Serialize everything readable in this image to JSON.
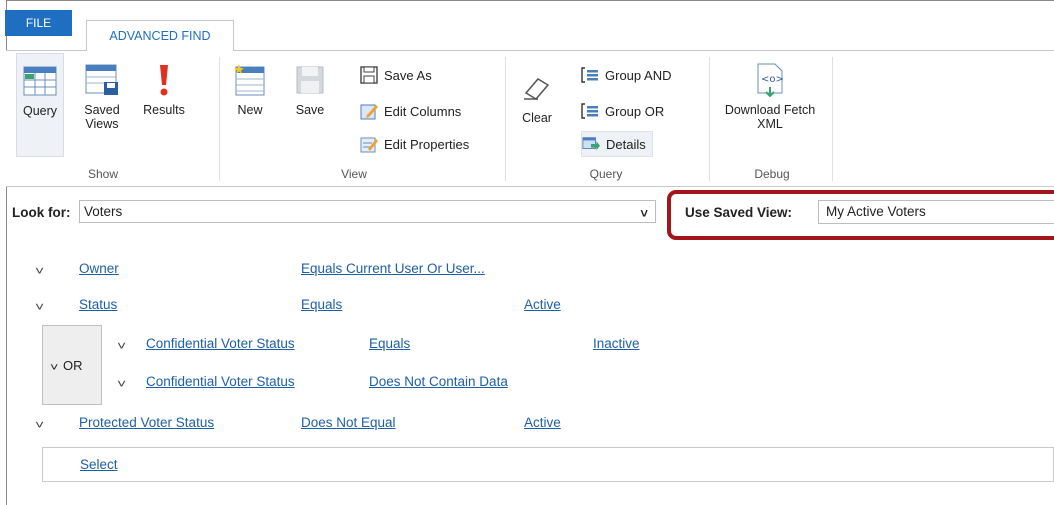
{
  "tabs": {
    "file": "FILE",
    "advanced_find": "ADVANCED FIND"
  },
  "ribbon": {
    "show": {
      "label": "Show",
      "query": "Query",
      "saved_views": "Saved\nViews",
      "results": "Results"
    },
    "view": {
      "label": "View",
      "new": "New",
      "save": "Save",
      "save_as": "Save As",
      "edit_columns": "Edit Columns",
      "edit_properties": "Edit Properties"
    },
    "query": {
      "label": "Query",
      "clear": "Clear",
      "group_and": "Group AND",
      "group_or": "Group OR",
      "details": "Details"
    },
    "debug": {
      "label": "Debug",
      "download_fetch_xml": "Download Fetch\nXML"
    }
  },
  "lookfor": {
    "label": "Look for:",
    "value": "Voters"
  },
  "saved_view": {
    "label": "Use Saved View:",
    "value": "My Active Voters"
  },
  "criteria": [
    {
      "field": "Owner",
      "operator": "Equals Current User Or User...",
      "value": ""
    },
    {
      "field": "Status",
      "operator": "Equals",
      "value": "Active"
    },
    {
      "field": "Protected Voter Status",
      "operator": "Does Not Equal",
      "value": "Active"
    }
  ],
  "or_group": {
    "label": "OR",
    "rows": [
      {
        "field": "Confidential Voter Status",
        "operator": "Equals",
        "value": "Inactive"
      },
      {
        "field": "Confidential Voter Status",
        "operator": "Does Not Contain Data",
        "value": ""
      }
    ]
  },
  "select_label": "Select",
  "colors": {
    "accent": "#1e6fc2",
    "link": "#1d5fa8",
    "highlight": "#a3151b"
  }
}
